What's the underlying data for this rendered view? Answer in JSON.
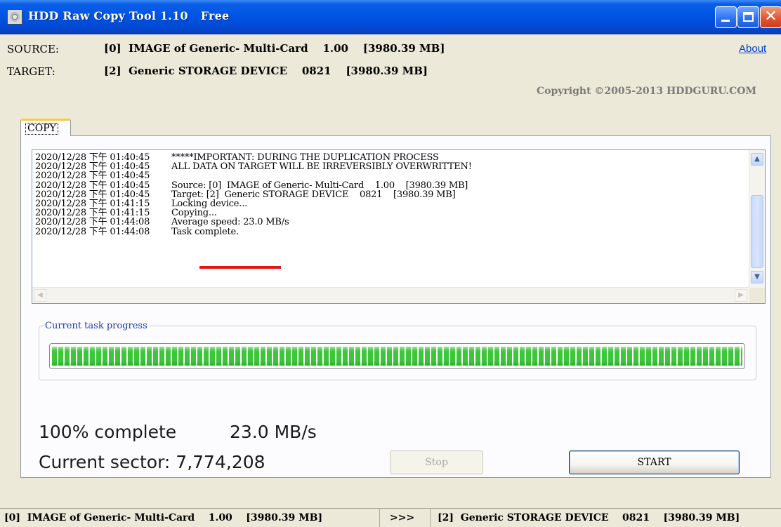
{
  "window": {
    "title": "HDD Raw Copy Tool 1.10",
    "edition": "Free"
  },
  "header": {
    "source_label": "SOURCE:",
    "source_value": "[0]  IMAGE of Generic- Multi-Card    1.00    [3980.39 MB]",
    "target_label": "TARGET:",
    "target_value": "[2]  Generic STORAGE DEVICE    0821    [3980.39 MB]",
    "about_link": "About",
    "copyright": "Copyright ©2005-2013 HDDGURU.COM"
  },
  "tabs": [
    {
      "label": "COPY",
      "selected": true
    }
  ],
  "log": {
    "lines": [
      {
        "time": "2020/12/28 下午 01:40:45",
        "message": "*****IMPORTANT: DURING THE DUPLICATION PROCESS"
      },
      {
        "time": "2020/12/28 下午 01:40:45",
        "message": "ALL DATA ON TARGET WILL BE IRREVERSIBLY OVERWRITTEN!"
      },
      {
        "time": "2020/12/28 下午 01:40:45",
        "message": ""
      },
      {
        "time": "2020/12/28 下午 01:40:45",
        "message": "Source: [0]  IMAGE of Generic- Multi-Card    1.00    [3980.39 MB]"
      },
      {
        "time": "2020/12/28 下午 01:40:45",
        "message": "Target: [2]  Generic STORAGE DEVICE    0821    [3980.39 MB]"
      },
      {
        "time": "2020/12/28 下午 01:41:15",
        "message": "Locking device..."
      },
      {
        "time": "2020/12/28 下午 01:41:15",
        "message": "Copying..."
      },
      {
        "time": "2020/12/28 下午 01:44:08",
        "message": "Average speed: 23.0 MB/s"
      },
      {
        "time": "2020/12/28 下午 01:44:08",
        "message": "Task complete."
      }
    ]
  },
  "progress": {
    "group_label": "Current task progress",
    "fraction": 1.0,
    "fill_color": "#3ec63b"
  },
  "stats": {
    "percent_text": "100% complete",
    "speed_text": "23.0 MB/s",
    "sector_text": "Current sector: 7,774,208"
  },
  "buttons": {
    "stop_label": "Stop",
    "stop_enabled": false,
    "start_label": "START"
  },
  "statusbar": {
    "source": "[0]  IMAGE of Generic- Multi-Card    1.00    [3980.39 MB]",
    "arrow": ">>>",
    "target": "[2]  Generic STORAGE DEVICE    0821    [3980.39 MB]"
  },
  "colors": {
    "title_bar": "#0055e5",
    "highlight_underline": "#e0161c",
    "progress_green": "#3ec63b",
    "about_link": "#0044cc"
  },
  "icons": {
    "app": "hdd-icon",
    "minimize": "minimize-icon",
    "maximize": "maximize-icon",
    "close": "close-icon"
  }
}
